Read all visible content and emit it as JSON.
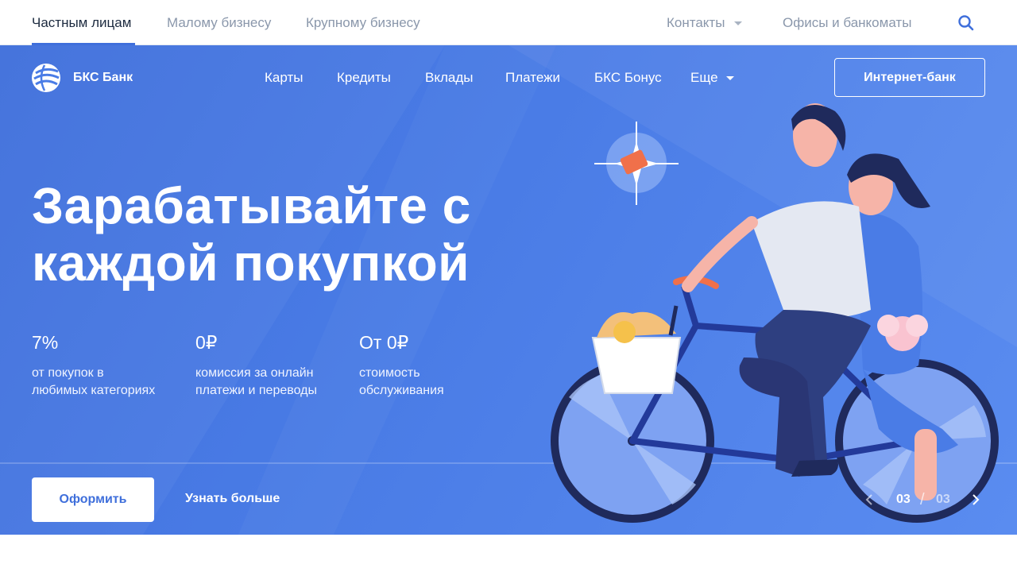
{
  "topbar": {
    "segments": [
      {
        "label": "Частным лицам",
        "active": true
      },
      {
        "label": "Малому бизнесу",
        "active": false
      },
      {
        "label": "Крупному бизнесу",
        "active": false
      }
    ],
    "contacts_label": "Контакты",
    "offices_label": "Офисы и банкоматы",
    "search_icon": "search-icon"
  },
  "header": {
    "logo_text": "БКС Банк",
    "logo_icon": "globe-logo-icon",
    "nav": [
      "Карты",
      "Кредиты",
      "Вклады",
      "Платежи",
      "БКС Бонус",
      "Еще"
    ],
    "internet_bank_label": "Интернет-банк"
  },
  "hero": {
    "headline_line1": "Зарабатывайте с",
    "headline_line2": "каждой покупкой",
    "stats": [
      {
        "value": "7%",
        "desc_line1": "от покупок в",
        "desc_line2": "любимых категориях"
      },
      {
        "value": "0₽",
        "desc_line1": "комиссия за онлайн",
        "desc_line2": "платежи и переводы"
      },
      {
        "value": "От 0₽",
        "desc_line1": "стоимость",
        "desc_line2": "обслуживания"
      }
    ],
    "primary_cta": "Оформить",
    "secondary_cta": "Узнать больше",
    "slider": {
      "current": "03",
      "separator": "/",
      "total": "03"
    }
  },
  "colors": {
    "accent": "#3f6fdb",
    "hero_bg": "#4a7ce6",
    "text_dark": "#1c2a3f",
    "text_muted": "#8a97ab"
  }
}
